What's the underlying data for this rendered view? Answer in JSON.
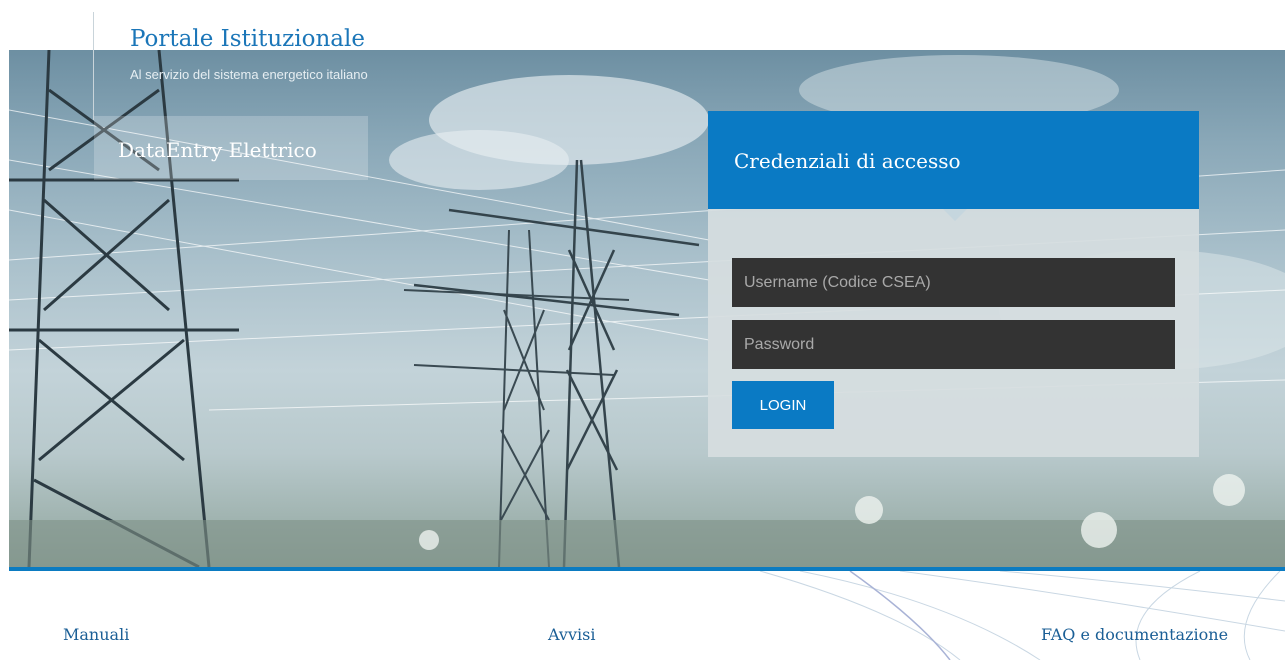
{
  "header": {
    "title": "Portale Istituzionale",
    "subtitle": "Al servizio del sistema energetico italiano"
  },
  "app": {
    "name": "DataEntry Elettrico"
  },
  "login": {
    "title": "Credenziali di accesso",
    "username_placeholder": "Username (Codice CSEA)",
    "username_value": "",
    "password_placeholder": "Password",
    "password_value": "",
    "button_label": "LOGIN"
  },
  "footer": {
    "links": [
      {
        "label": "Manuali"
      },
      {
        "label": "Avvisi"
      },
      {
        "label": "FAQ e documentazione"
      }
    ]
  },
  "colors": {
    "accent": "#0a7ac4",
    "title_blue": "#1b76b8",
    "field_bg": "#333333"
  }
}
